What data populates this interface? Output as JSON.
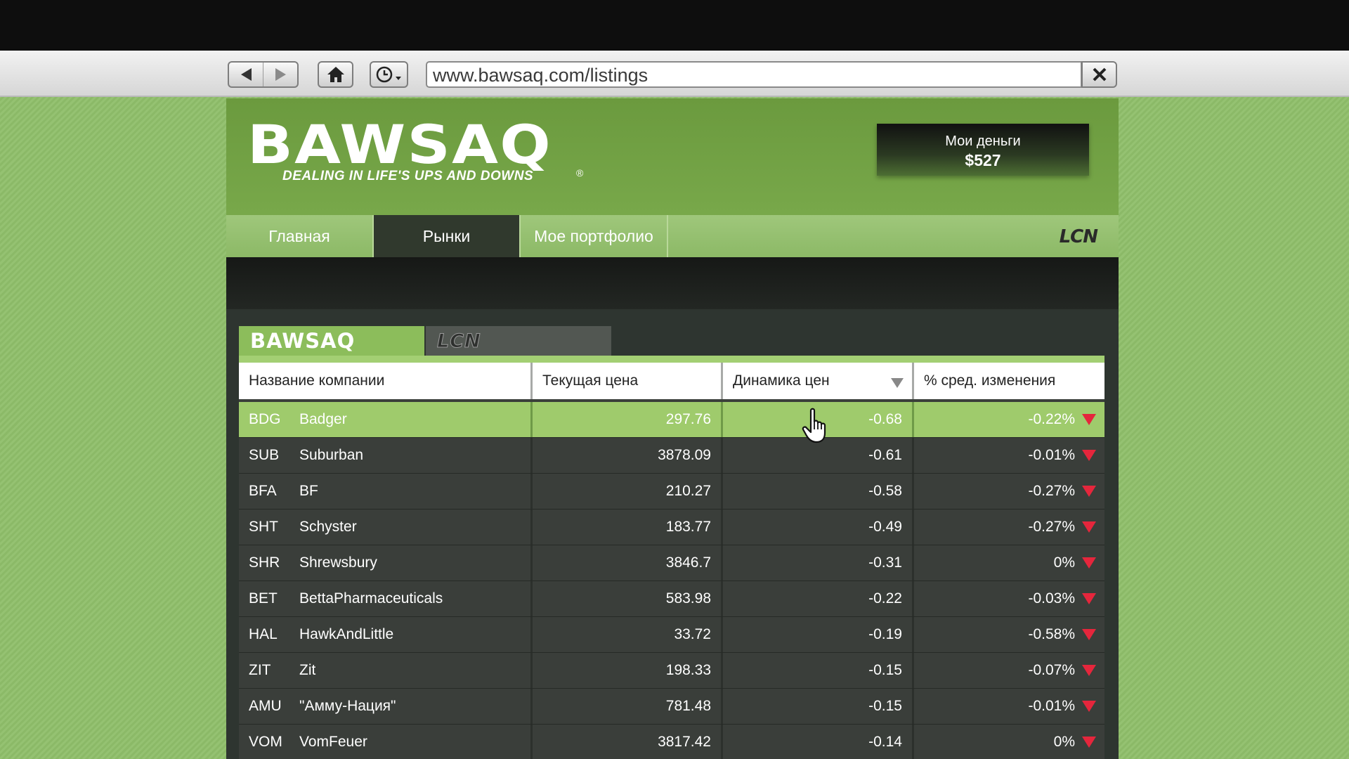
{
  "browser": {
    "url": "www.bawsaq.com/listings"
  },
  "site": {
    "logo": "BAWSAQ",
    "tagline": "DEALING IN LIFE'S UPS AND DOWNS",
    "registered_mark": "®",
    "money_label": "Мои деньги",
    "money_value": "$527",
    "nav": [
      "Главная",
      "Рынки",
      "Мое портфолио"
    ],
    "nav_active": "Рынки",
    "partner_logo": "LCN",
    "market_tabs": [
      "BAWSAQ",
      "LCN"
    ]
  },
  "table": {
    "headers": [
      "Название компании",
      "Текущая цена",
      "Динамика цен",
      "% сред. изменения"
    ],
    "rows": [
      {
        "ticker": "BDG",
        "name": "Badger",
        "price": "297.76",
        "change": "-0.68",
        "pct": "-0.22%"
      },
      {
        "ticker": "SUB",
        "name": "Suburban",
        "price": "3878.09",
        "change": "-0.61",
        "pct": "-0.01%"
      },
      {
        "ticker": "BFA",
        "name": "BF",
        "price": "210.27",
        "change": "-0.58",
        "pct": "-0.27%"
      },
      {
        "ticker": "SHT",
        "name": "Schyster",
        "price": "183.77",
        "change": "-0.49",
        "pct": "-0.27%"
      },
      {
        "ticker": "SHR",
        "name": "Shrewsbury",
        "price": "3846.7",
        "change": "-0.31",
        "pct": "0%"
      },
      {
        "ticker": "BET",
        "name": "BettaPharmaceuticals",
        "price": "583.98",
        "change": "-0.22",
        "pct": "-0.03%"
      },
      {
        "ticker": "HAL",
        "name": "HawkAndLittle",
        "price": "33.72",
        "change": "-0.19",
        "pct": "-0.58%"
      },
      {
        "ticker": "ZIT",
        "name": "Zit",
        "price": "198.33",
        "change": "-0.15",
        "pct": "-0.07%"
      },
      {
        "ticker": "AMU",
        "name": "\"Амму-Нация\"",
        "price": "781.48",
        "change": "-0.15",
        "pct": "-0.01%"
      },
      {
        "ticker": "VOM",
        "name": "VomFeuer",
        "price": "3817.42",
        "change": "-0.14",
        "pct": "0%"
      }
    ]
  },
  "colors": {
    "brand_green": "#78a84a",
    "selected_row": "#9fcb6c",
    "down_arrow": "#e5263c"
  }
}
